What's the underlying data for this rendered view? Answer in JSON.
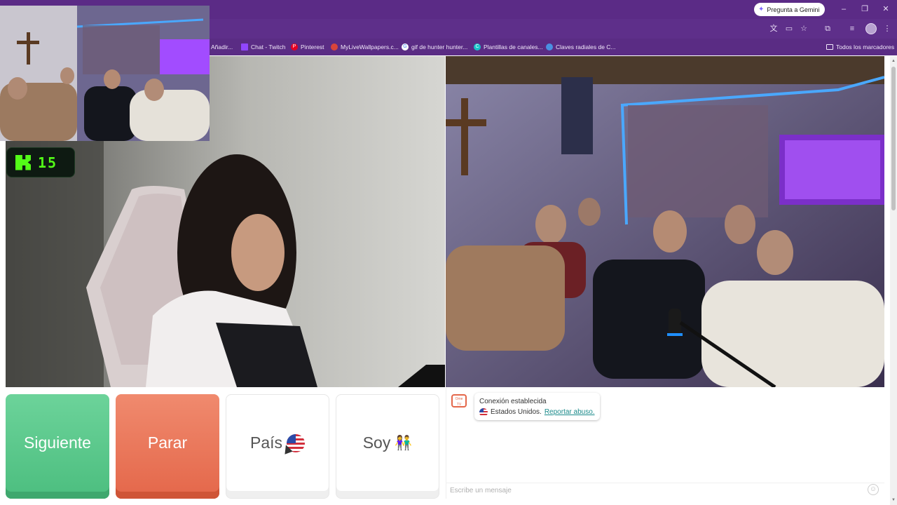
{
  "browser": {
    "gemini_label": "Pregunta a Gemini",
    "window_controls": [
      "–",
      "❐",
      "✕"
    ],
    "bookmarks": [
      {
        "label": "Añadir...",
        "icon": "add-icon"
      },
      {
        "label": "Chat - Twitch",
        "icon": "twitch-icon"
      },
      {
        "label": "Pinterest",
        "icon": "pinterest-icon"
      },
      {
        "label": "MyLiveWallpapers.c...",
        "icon": "wallpaper-icon"
      },
      {
        "label": "gif de hunter hunter...",
        "icon": "google-icon"
      },
      {
        "label": "Plantillas de canales...",
        "icon": "canva-icon"
      },
      {
        "label": "Claves radiales de C...",
        "icon": "site-icon"
      }
    ],
    "all_bookmarks": "Todos los marcadores"
  },
  "overlay": {
    "kick_count": "15"
  },
  "controls": {
    "next_label": "Siguiente",
    "stop_label": "Parar",
    "country_label": "País",
    "iam_label": "Soy",
    "colors": {
      "next": "#4cbe7f",
      "stop": "#e4674a"
    }
  },
  "chat": {
    "logo_text": "Ome TV",
    "connection_text": "Conexión establecida",
    "country_text": "Estados Unidos.",
    "report_link": "Reportar abuso.",
    "input_placeholder": "Escribe un mensaje"
  }
}
